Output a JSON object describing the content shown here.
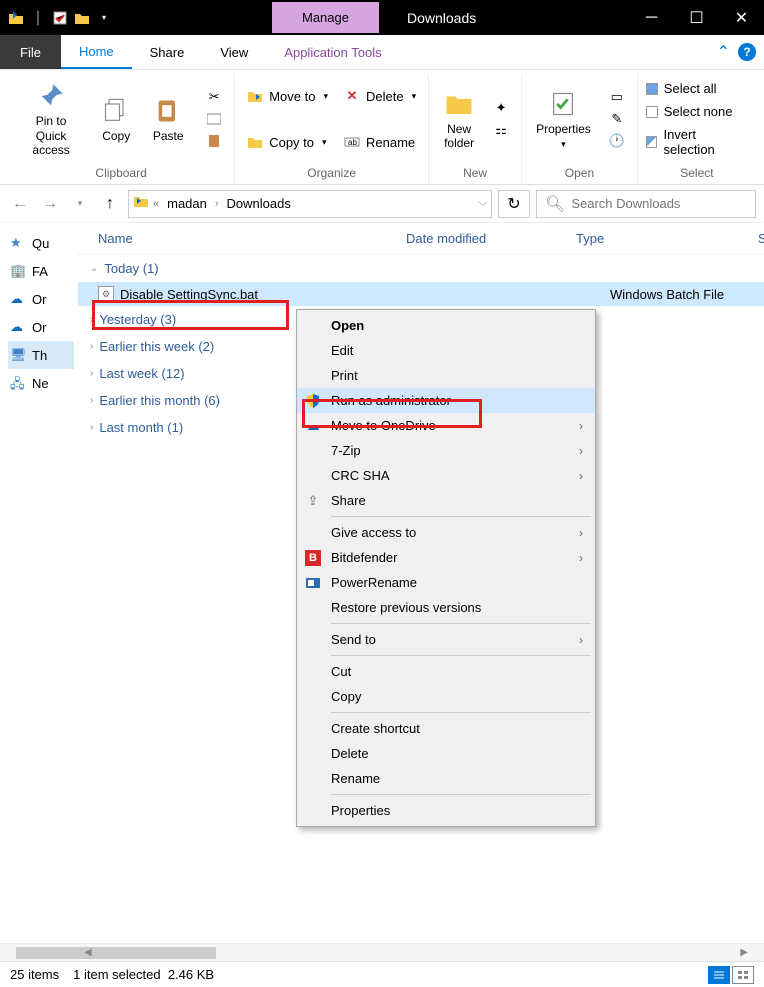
{
  "titlebar": {
    "manage_tab": "Manage",
    "title": "Downloads"
  },
  "ribbon_tabs": {
    "file": "File",
    "home": "Home",
    "share": "Share",
    "view": "View",
    "application_tools": "Application Tools"
  },
  "ribbon": {
    "pin": "Pin to Quick\naccess",
    "copy": "Copy",
    "paste": "Paste",
    "clipboard_label": "Clipboard",
    "move_to": "Move to",
    "copy_to": "Copy to",
    "delete": "Delete",
    "rename": "Rename",
    "organize_label": "Organize",
    "new_folder": "New\nfolder",
    "new_label": "New",
    "properties": "Properties",
    "open_label": "Open",
    "select_all": "Select all",
    "select_none": "Select none",
    "invert_selection": "Invert selection",
    "select_label": "Select"
  },
  "breadcrumb": {
    "part1": "madan",
    "part2": "Downloads"
  },
  "search_placeholder": "Search Downloads",
  "tree": {
    "quick": "Qu",
    "fav": "FA",
    "one1": "Or",
    "one2": "Or",
    "thispc": "Th",
    "network": "Ne"
  },
  "columns": {
    "name": "Name",
    "date": "Date modified",
    "type": "Type",
    "s": "S"
  },
  "groups": {
    "today": "Today (1)",
    "yesterday": "Yesterday (3)",
    "earlier_week": "Earlier this week (2)",
    "last_week": "Last week (12)",
    "earlier_month": "Earlier this month (6)",
    "last_month": "Last month (1)"
  },
  "file": {
    "name": "Disable SettingSync.bat",
    "type": "Windows Batch File"
  },
  "context": {
    "open": "Open",
    "edit": "Edit",
    "print": "Print",
    "run_admin": "Run as administrator",
    "move_onedrive": "Move to OneDrive",
    "sevenzip": "7-Zip",
    "crcsha": "CRC SHA",
    "share": "Share",
    "give_access": "Give access to",
    "bitdefender": "Bitdefender",
    "powerrename": "PowerRename",
    "restore": "Restore previous versions",
    "send_to": "Send to",
    "cut": "Cut",
    "copy": "Copy",
    "shortcut": "Create shortcut",
    "delete": "Delete",
    "rename": "Rename",
    "properties": "Properties"
  },
  "status": {
    "items": "25 items",
    "selected": "1 item selected",
    "size": "2.46 KB"
  }
}
